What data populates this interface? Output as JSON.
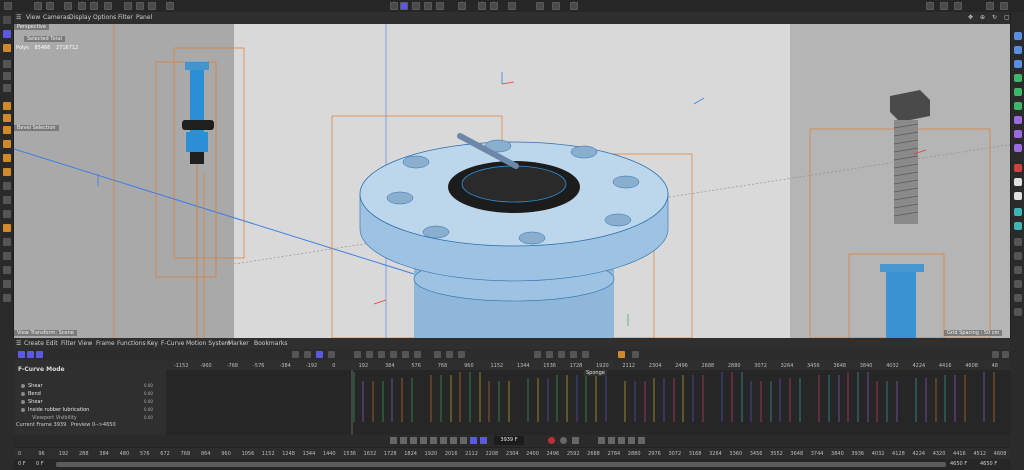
{
  "menubar": {
    "items": [
      "View",
      "Cameras",
      "Display",
      "Options",
      "Filter",
      "Panel"
    ]
  },
  "viewport": {
    "camera_label": "Perspective",
    "selected_label": "Selected Total",
    "polys_label": "Polys",
    "polys_value": "85466",
    "polys_total": "2716712",
    "object_label_1": "Bevel Selection",
    "object_label_2": "View Transform: Scene",
    "grid_spacing": "Grid Spacing : 50 cm"
  },
  "timeline_menu": {
    "items": [
      "Create",
      "Edit",
      "Filter",
      "View",
      "Frame",
      "Functions",
      "Key",
      "F-Curve",
      "Motion System",
      "Marker",
      "Bookmarks"
    ]
  },
  "fcurve": {
    "mode_label": "F-Curve Mode",
    "tracks": [
      {
        "name": "Shear",
        "value": "0.00"
      },
      {
        "name": "Bend",
        "value": "0.00"
      },
      {
        "name": "Shear",
        "value": "0.00"
      },
      {
        "name": "Inside rubber lubrication",
        "value": "0.00"
      },
      {
        "name": "Viewport Visibility",
        "value": "0.00"
      }
    ],
    "current_frame_label": "Current Frame",
    "current_frame_value": "3939",
    "preview_label": "Preview",
    "preview_range": "0-->4650",
    "marker_label": "Sponge",
    "ruler_ticks": [
      "-1152",
      "-960",
      "-768",
      "-576",
      "-384",
      "-192",
      "0",
      "192",
      "384",
      "576",
      "768",
      "960",
      "1152",
      "1344",
      "1536",
      "1728",
      "1920",
      "2112",
      "2304",
      "2496",
      "2688",
      "2880",
      "3072",
      "3264",
      "3456",
      "3648",
      "3840",
      "4032",
      "4224",
      "4416",
      "4608",
      "48"
    ]
  },
  "transport": {
    "frame_value": "3939 F"
  },
  "bottom_ruler": {
    "ticks": [
      "0",
      "96",
      "192",
      "288",
      "384",
      "480",
      "576",
      "672",
      "768",
      "864",
      "960",
      "1056",
      "1152",
      "1248",
      "1344",
      "1440",
      "1536",
      "1632",
      "1728",
      "1824",
      "1920",
      "2016",
      "2112",
      "2208",
      "2304",
      "2400",
      "2496",
      "2592",
      "2688",
      "2784",
      "2880",
      "2976",
      "3072",
      "3168",
      "3264",
      "3360",
      "3456",
      "3552",
      "3648",
      "3744",
      "3840",
      "3936",
      "4032",
      "4128",
      "4224",
      "4320",
      "4416",
      "4512",
      "4608"
    ]
  },
  "range": {
    "start_a": "0 F",
    "start_b": "0 F",
    "end_a": "4650 F",
    "end_b": "4650 F",
    "fill_fraction": 1.0
  },
  "colors": {
    "accent": "#5a5ae0",
    "wire": "#2b8fd6",
    "bbox": "#e07b2a"
  }
}
